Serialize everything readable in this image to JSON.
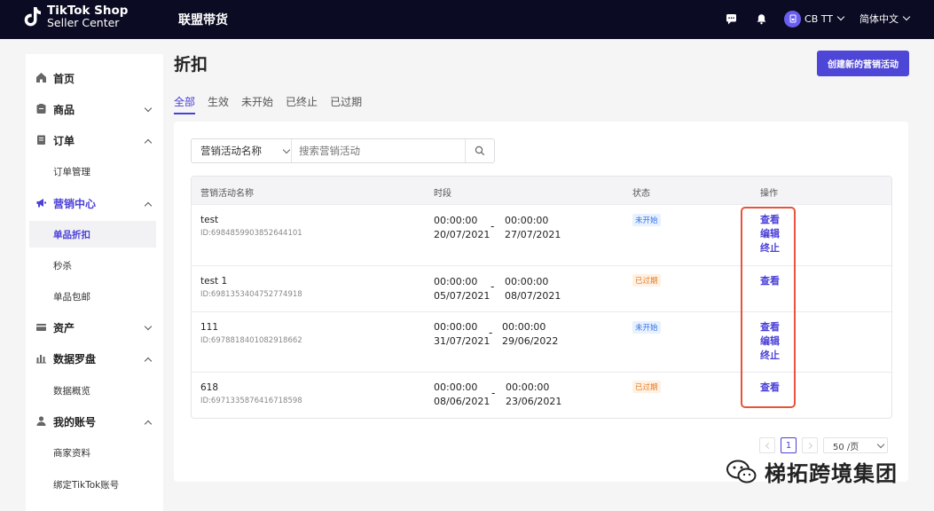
{
  "header": {
    "logo_line1": "TikTok Shop",
    "logo_line2": "Seller Center",
    "module_title": "联盟带货",
    "user_name": "CB TT",
    "language": "简体中文",
    "bg_color": "#0b0b23"
  },
  "sidebar": {
    "items": [
      {
        "label": "首页",
        "icon": "home-icon"
      },
      {
        "label": "商品",
        "icon": "product-icon"
      },
      {
        "label": "订单",
        "icon": "order-icon"
      },
      {
        "label": "订单管理"
      },
      {
        "label": "营销中心",
        "icon": "megaphone-icon"
      },
      {
        "label": "单品折扣"
      },
      {
        "label": "秒杀"
      },
      {
        "label": "单品包邮"
      },
      {
        "label": "资产",
        "icon": "wallet-icon"
      },
      {
        "label": "数据罗盘",
        "icon": "bar-chart-icon"
      },
      {
        "label": "数据概览"
      },
      {
        "label": "我的账号",
        "icon": "user-icon"
      },
      {
        "label": "商家资料"
      },
      {
        "label": "绑定TikTok账号"
      }
    ]
  },
  "main": {
    "title": "折扣",
    "create_button": "创建新的营销活动",
    "tabs": [
      "全部",
      "生效",
      "未开始",
      "已终止",
      "已过期"
    ],
    "active_tab": "全部",
    "search": {
      "field_select": "营销活动名称",
      "placeholder": "搜索营销活动"
    },
    "table": {
      "headers": [
        "营销活动名称",
        "时段",
        "状态",
        "操作"
      ],
      "rows": [
        {
          "name": "test",
          "id": "ID:6984859903852644101",
          "start_time": "00:00:00",
          "start_date": "20/07/2021",
          "end_time": "00:00:00",
          "end_date": "27/07/2021",
          "status": "未开始",
          "actions": [
            "查看",
            "编辑",
            "终止"
          ]
        },
        {
          "name": "test 1",
          "id": "ID:6981353404752774918",
          "start_time": "00:00:00",
          "start_date": "05/07/2021",
          "end_time": "00:00:00",
          "end_date": "08/07/2021",
          "status": "已过期",
          "actions": [
            "查看"
          ]
        },
        {
          "name": "111",
          "id": "ID:6978818401082918662",
          "start_time": "00:00:00",
          "start_date": "31/07/2021",
          "end_time": "00:00:00",
          "end_date": "29/06/2022",
          "status": "未开始",
          "actions": [
            "查看",
            "编辑",
            "终止"
          ]
        },
        {
          "name": "618",
          "id": "ID:6971335876416718598",
          "start_time": "00:00:00",
          "start_date": "08/06/2021",
          "end_time": "00:00:00",
          "end_date": "23/06/2021",
          "status": "已过期",
          "actions": [
            "查看"
          ]
        }
      ],
      "dash": "-"
    },
    "pagination": {
      "current_page": "1",
      "page_size": "50 /页"
    }
  },
  "watermark": {
    "text": "梯拓跨境集团"
  },
  "colors": {
    "accent": "#4a40d8",
    "highlight_box": "#e8533a"
  }
}
